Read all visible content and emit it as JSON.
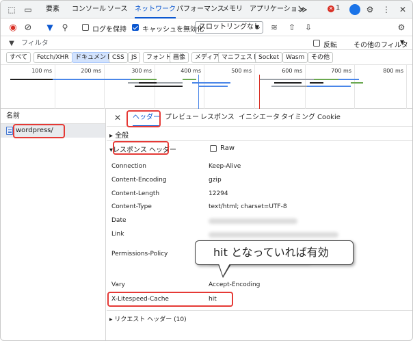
{
  "top_tabs": [
    "要素",
    "コンソール",
    "ソース",
    "ネットワーク",
    "パフォーマンス",
    "メモリ",
    "アプリケーション"
  ],
  "more_tabs": "≫",
  "error_count": "1",
  "toolbar": {
    "preserve_log": "ログを保持",
    "disable_cache": "キャッシュを無効化",
    "throttling": "スロットリングなし"
  },
  "filter": {
    "placeholder": "フィルタ",
    "invert": "反転",
    "other_filters": "その他のフィルタ"
  },
  "type_chips": [
    "すべて",
    "Fetch/XHR",
    "ドキュメント",
    "CSS",
    "JS",
    "フォント",
    "画像",
    "メディア",
    "マニフェスト",
    "Socket",
    "Wasm",
    "その他"
  ],
  "timeline_ticks": [
    "100 ms",
    "200 ms",
    "300 ms",
    "400 ms",
    "500 ms",
    "600 ms",
    "700 ms",
    "800 ms"
  ],
  "request_list": {
    "header": "名前",
    "items": [
      "wordpress/"
    ]
  },
  "detail_tabs": [
    "ヘッダー",
    "プレビュー",
    "レスポンス",
    "イニシエータ",
    "タイミング",
    "Cookie"
  ],
  "sections": {
    "general": "全般",
    "response_headers": "レスポンス ヘッダー",
    "raw": "Raw",
    "request_headers": "リクエスト ヘッダー",
    "request_headers_count": "(10)"
  },
  "response_headers": [
    {
      "name": "Connection",
      "value": "Keep-Alive"
    },
    {
      "name": "Content-Encoding",
      "value": "gzip"
    },
    {
      "name": "Content-Length",
      "value": "12294"
    },
    {
      "name": "Content-Type",
      "value": "text/html; charset=UTF-8"
    },
    {
      "name": "Date",
      "value": ""
    },
    {
      "name": "Link",
      "value": ""
    },
    {
      "name": "Permissions-Policy",
      "value": ""
    },
    {
      "name": "Vary",
      "value": "Accept-Encoding"
    },
    {
      "name": "X-Litespeed-Cache",
      "value": "hit"
    }
  ],
  "callout": "hit となっていれば有効",
  "colors": {
    "accent": "#0b57d0",
    "annotation": "#e53935"
  }
}
